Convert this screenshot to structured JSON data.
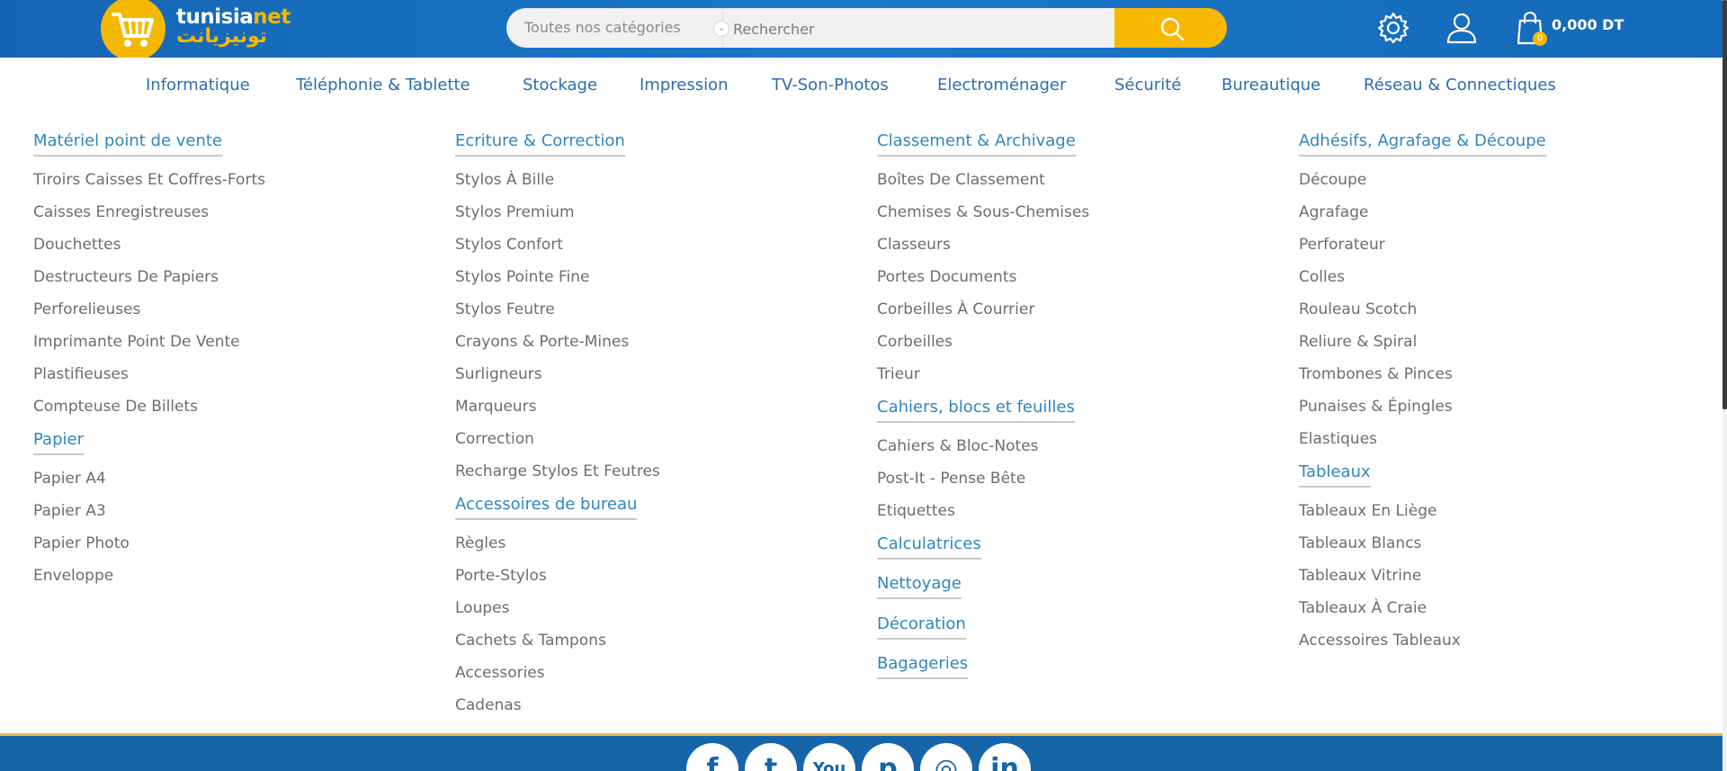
{
  "brand": {
    "name_latin_1": "tunisia",
    "name_latin_2": "net",
    "name_arabic": "تونيزيانت",
    "colors": {
      "primary": "#1565b5",
      "accent": "#f5b800",
      "link": "#2a6db0"
    }
  },
  "search": {
    "category_label": "Toutes nos catégories",
    "placeholder": "Rechercher"
  },
  "header": {
    "cart_count": "0",
    "cart_amount": "0,000 DT",
    "icons": [
      "cart-logo-icon",
      "settings-gear-icon",
      "user-icon",
      "shopping-bag-icon",
      "search-icon"
    ]
  },
  "nav": {
    "items": [
      "Informatique",
      "Téléphonie & Tablette",
      "Stockage",
      "Impression",
      "TV-Son-Photos",
      "Electroménager",
      "Sécurité",
      "Bureautique",
      "Réseau & Connectiques"
    ]
  },
  "mega_menu": {
    "columns": [
      {
        "sections": [
          {
            "title": "Matériel point de vente",
            "items": [
              "Tiroirs Caisses Et Coffres-Forts",
              "Caisses Enregistreuses",
              "Douchettes",
              "Destructeurs De Papiers",
              "Perforelieuses",
              "Imprimante Point De Vente",
              "Plastifieuses",
              "Compteuse De Billets"
            ]
          },
          {
            "title": "Papier",
            "items": [
              "Papier A4",
              "Papier A3",
              "Papier Photo",
              "Enveloppe"
            ]
          }
        ]
      },
      {
        "sections": [
          {
            "title": "Ecriture & Correction",
            "items": [
              "Stylos À Bille",
              "Stylos Premium",
              "Stylos Confort",
              "Stylos Pointe Fine",
              "Stylos Feutre",
              "Crayons & Porte-Mines",
              "Surligneurs",
              "Marqueurs",
              "Correction",
              "Recharge Stylos Et Feutres"
            ]
          },
          {
            "title": "Accessoires de bureau",
            "items": [
              "Règles",
              "Porte-Stylos",
              "Loupes",
              "Cachets & Tampons",
              "Accessories",
              "Cadenas"
            ]
          }
        ]
      },
      {
        "sections": [
          {
            "title": "Classement & Archivage",
            "items": [
              "Boîtes De Classement",
              "Chemises & Sous-Chemises",
              "Classeurs",
              "Portes Documents",
              "Corbeilles À Courrier",
              "Corbeilles",
              "Trieur"
            ]
          },
          {
            "title": "Cahiers, blocs et feuilles",
            "items": [
              "Cahiers & Bloc-Notes",
              "Post-It - Pense Bête",
              "Etiquettes"
            ]
          },
          {
            "title": "Calculatrices",
            "items": []
          },
          {
            "title": "Nettoyage",
            "items": []
          },
          {
            "title": "Décoration",
            "items": []
          },
          {
            "title": "Bagageries",
            "items": []
          }
        ]
      },
      {
        "sections": [
          {
            "title": "Adhésifs, Agrafage & Découpe",
            "items": [
              "Découpe",
              "Agrafage",
              "Perforateur",
              "Colles",
              "Rouleau Scotch",
              "Reliure & Spiral",
              "Trombones & Pinces",
              "Punaises & Épingles",
              "Elastiques"
            ]
          },
          {
            "title": "Tableaux",
            "items": [
              "Tableaux En Liège",
              "Tableaux Blancs",
              "Tableaux Vitrine",
              "Tableaux À Craie",
              "Accessoires Tableaux"
            ]
          }
        ]
      }
    ]
  },
  "footer": {
    "social": [
      {
        "name": "facebook-icon",
        "glyph": "f"
      },
      {
        "name": "twitter-icon",
        "glyph": "t"
      },
      {
        "name": "youtube-icon",
        "glyph": "You"
      },
      {
        "name": "pinterest-icon",
        "glyph": "p"
      },
      {
        "name": "instagram-icon",
        "glyph": "◎"
      },
      {
        "name": "linkedin-icon",
        "glyph": "in"
      }
    ]
  }
}
